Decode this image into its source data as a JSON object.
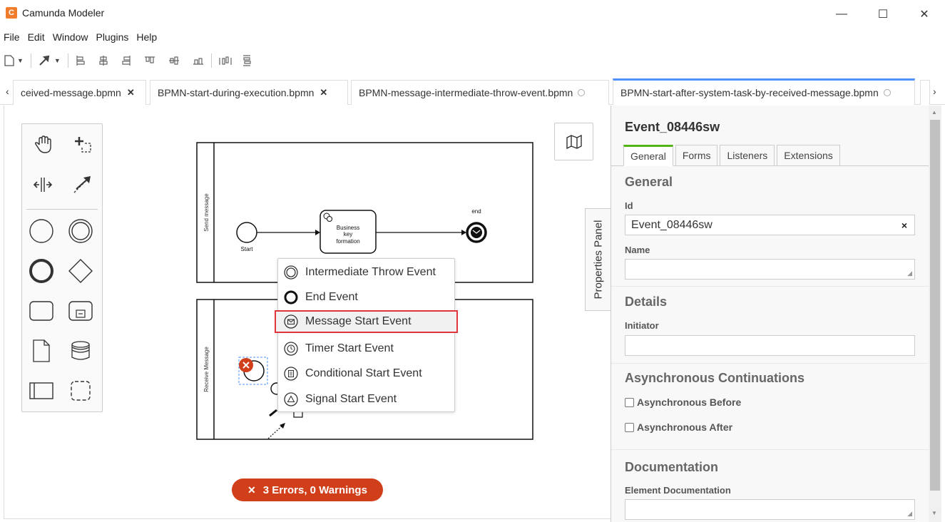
{
  "window": {
    "title": "Camunda Modeler",
    "logo_letter": "C",
    "controls": {
      "minimize": "—",
      "maximize": "☐",
      "close": "✕"
    }
  },
  "menu": [
    "File",
    "Edit",
    "Window",
    "Plugins",
    "Help"
  ],
  "tabs": [
    {
      "label": "ceived-message.bpmn",
      "closable": true
    },
    {
      "label": "BPMN-start-during-execution.bpmn",
      "closable": true
    },
    {
      "label": "BPMN-message-intermediate-throw-event.bpmn",
      "closable": false
    },
    {
      "label": "BPMN-start-after-system-task-by-received-message.bpmn",
      "closable": false,
      "active": true
    }
  ],
  "tab_arrows": {
    "left": "‹",
    "right": "›"
  },
  "diagram": {
    "pool1": {
      "lane_label": "Send message"
    },
    "pool2": {
      "lane_label": "Receive Message"
    },
    "start_label": "Start",
    "task_label_lines": [
      "Business",
      "key",
      "formation"
    ],
    "end_label": "end"
  },
  "popup_menu": {
    "items": [
      {
        "label": "Intermediate Throw Event",
        "icon": "intermediate-throw-event-icon"
      },
      {
        "label": "End Event",
        "icon": "end-event-icon"
      },
      {
        "label": "Message Start Event",
        "icon": "message-start-event-icon",
        "selected": true
      },
      {
        "label": "Timer Start Event",
        "icon": "timer-start-event-icon"
      },
      {
        "label": "Conditional Start Event",
        "icon": "conditional-start-event-icon"
      },
      {
        "label": "Signal Start Event",
        "icon": "signal-start-event-icon"
      }
    ]
  },
  "errors_badge": {
    "icon": "✕",
    "text": "3 Errors, 0 Warnings"
  },
  "properties_toggle": "Properties Panel",
  "properties": {
    "element_id": "Event_08446sw",
    "tabs": [
      "General",
      "Forms",
      "Listeners",
      "Extensions"
    ],
    "active_tab": "General",
    "groups": {
      "general": {
        "title": "General",
        "id_label": "Id",
        "id_value": "Event_08446sw",
        "clear": "×",
        "name_label": "Name",
        "name_value": ""
      },
      "details": {
        "title": "Details",
        "initiator_label": "Initiator",
        "initiator_value": ""
      },
      "async": {
        "title": "Asynchronous Continuations",
        "before_label": "Asynchronous Before",
        "after_label": "Asynchronous After",
        "before_checked": false,
        "after_checked": false
      },
      "documentation": {
        "title": "Documentation",
        "element_doc_label": "Element Documentation",
        "element_doc_value": ""
      }
    }
  },
  "colors": {
    "error_badge": "#d13f1a",
    "popup_selected_border": "#e0353b",
    "active_tab_top": "#4d90fe",
    "props_active_tab_top": "#52b415",
    "logo": "#f17d2c"
  }
}
